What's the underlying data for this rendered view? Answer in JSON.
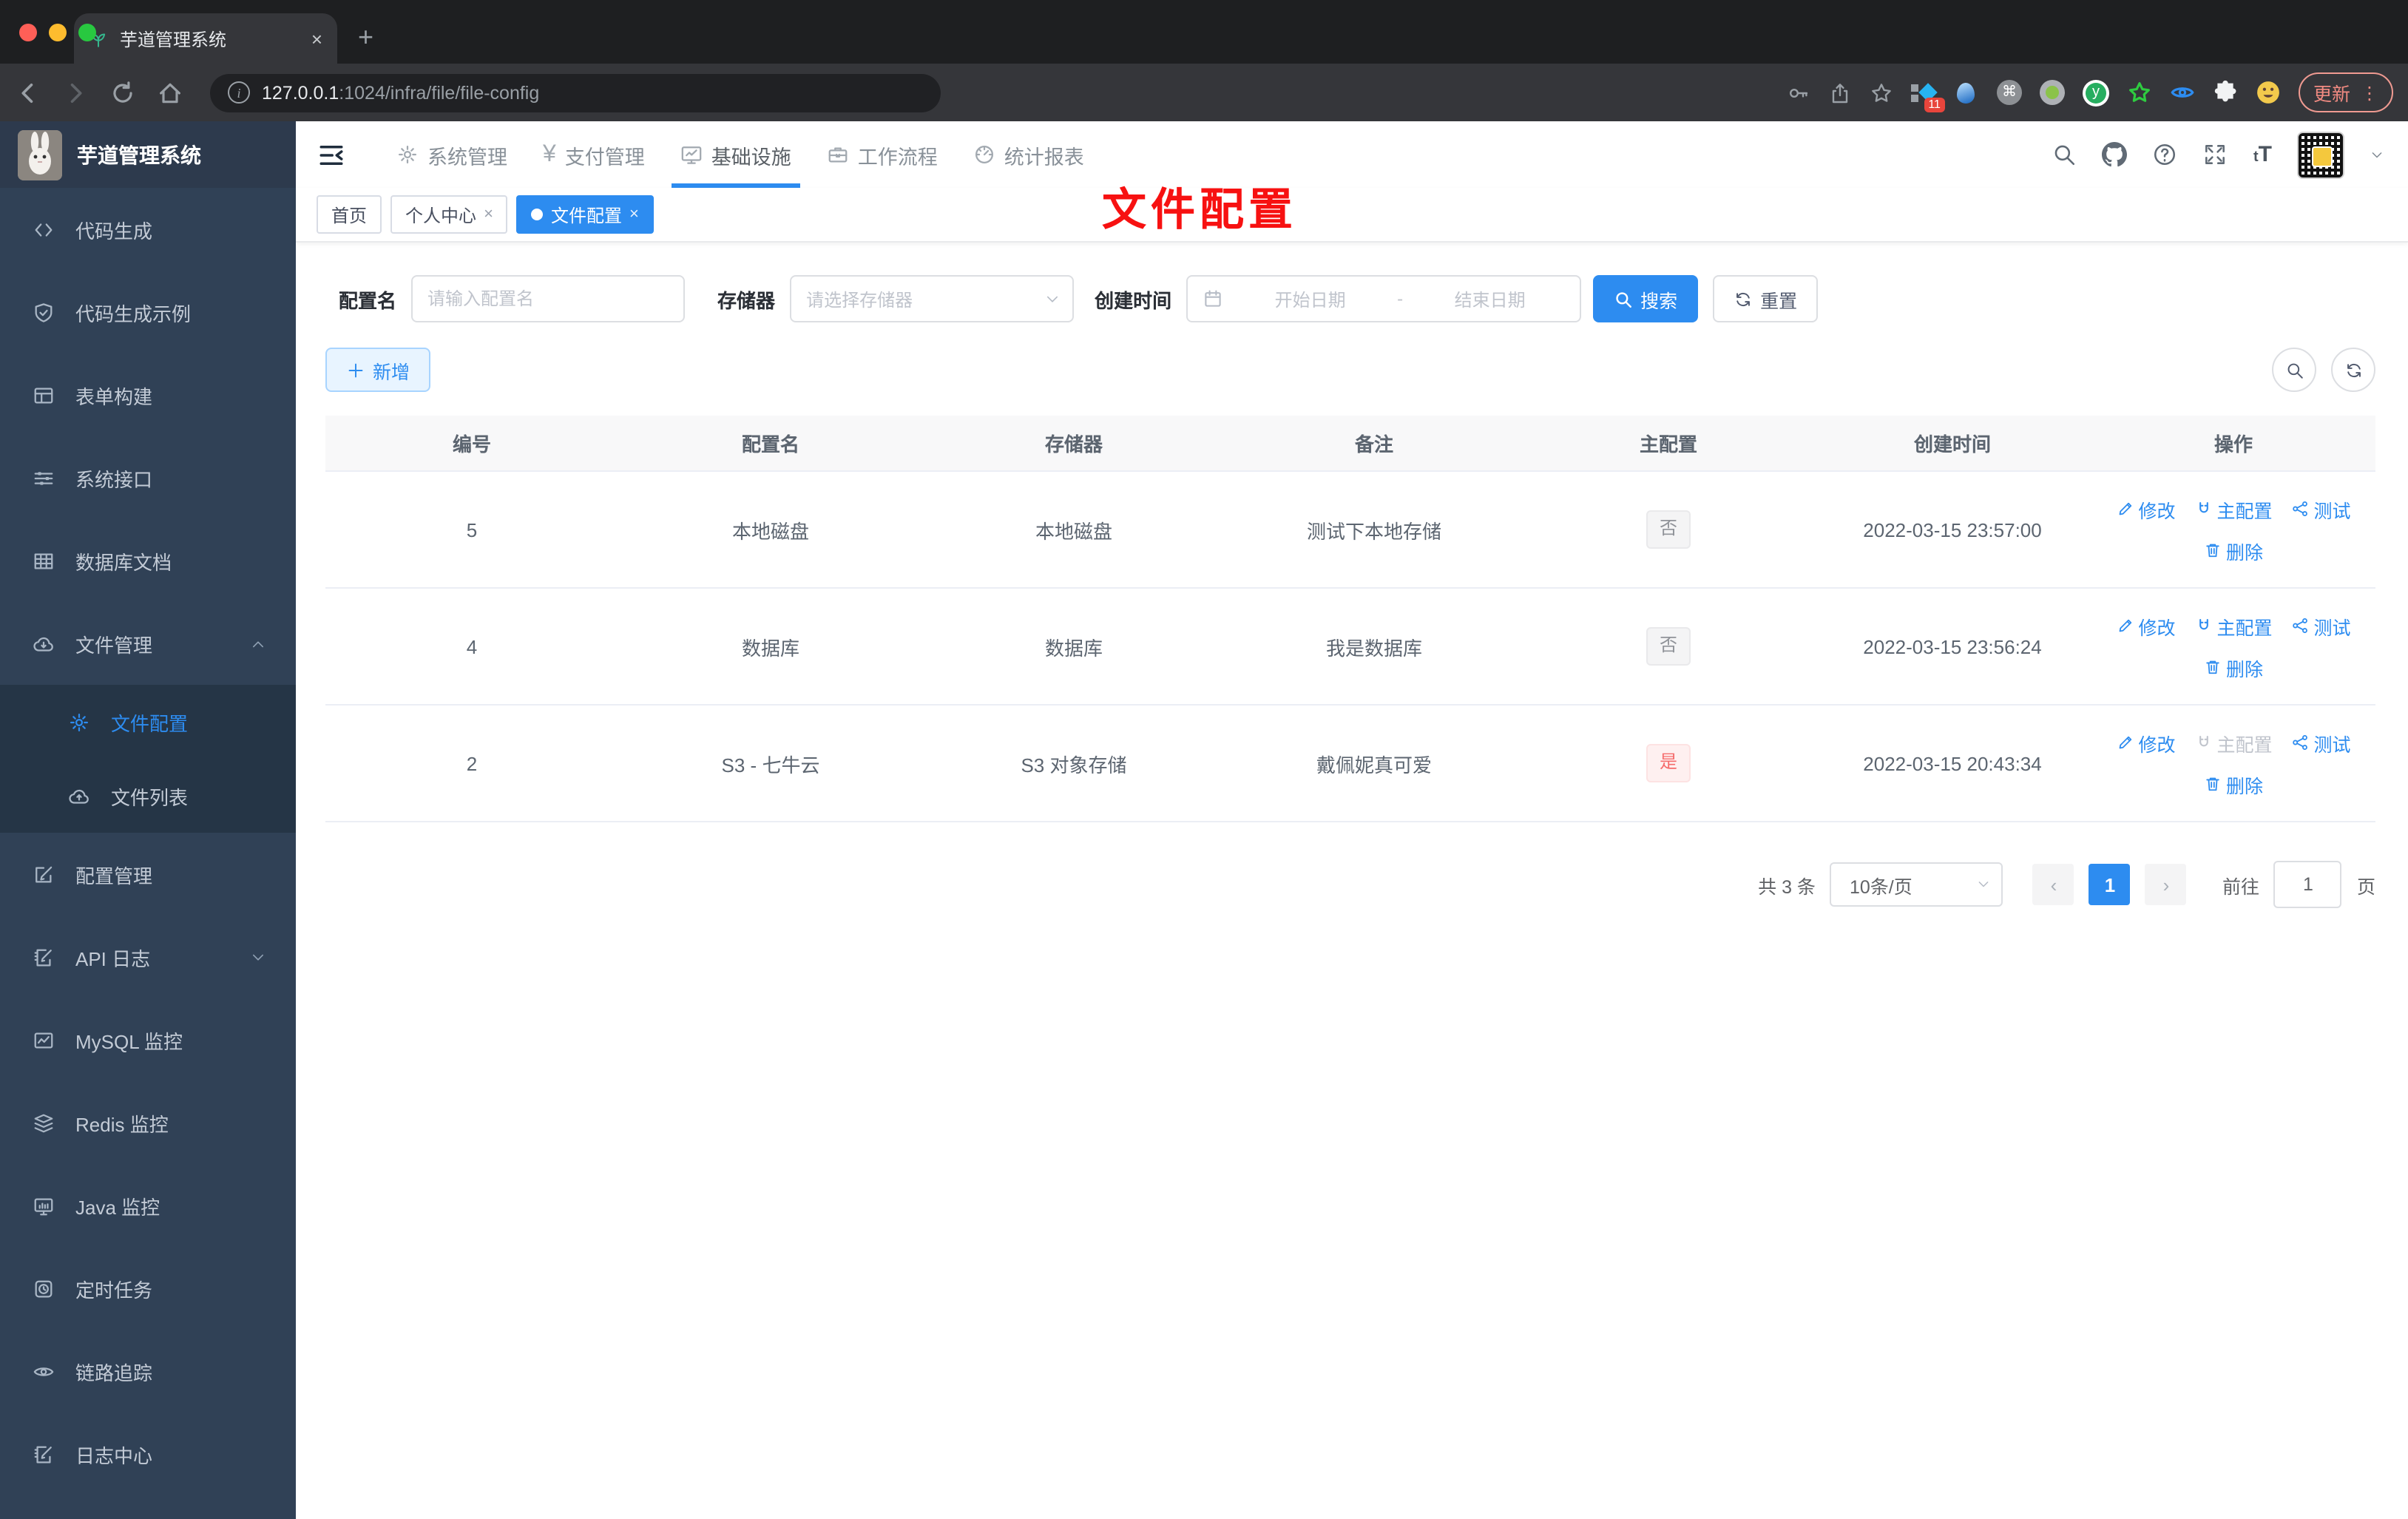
{
  "browser": {
    "tab_title": "芋道管理系统",
    "close_tab": "×",
    "new_tab": "+",
    "url_host": "127.0.0.1",
    "url_path": ":1024/infra/file/file-config",
    "ext_badge": "11",
    "update_label": "更新",
    "kebab": "⋮"
  },
  "sidebar": {
    "logo_title": "芋道管理系统",
    "items": [
      {
        "label": "代码生成",
        "icon": "code-icon"
      },
      {
        "label": "代码生成示例",
        "icon": "shield-check-icon"
      },
      {
        "label": "表单构建",
        "icon": "form-icon"
      },
      {
        "label": "系统接口",
        "icon": "sliders-icon"
      },
      {
        "label": "数据库文档",
        "icon": "grid-icon"
      },
      {
        "label": "文件管理",
        "icon": "cloud-download-icon"
      },
      {
        "label": "文件配置",
        "icon": "gear-icon"
      },
      {
        "label": "文件列表",
        "icon": "cloud-upload-icon"
      },
      {
        "label": "配置管理",
        "icon": "edit-square-icon"
      },
      {
        "label": "API 日志",
        "icon": "doc-pencil-icon"
      },
      {
        "label": "MySQL 监控",
        "icon": "chart-icon"
      },
      {
        "label": "Redis 监控",
        "icon": "layers-icon"
      },
      {
        "label": "Java 监控",
        "icon": "monitor-icon"
      },
      {
        "label": "定时任务",
        "icon": "timer-icon"
      },
      {
        "label": "链路追踪",
        "icon": "eye-icon"
      },
      {
        "label": "日志中心",
        "icon": "log-icon"
      }
    ]
  },
  "header": {
    "nav": [
      {
        "label": "系统管理",
        "icon": "gear-icon"
      },
      {
        "label": "支付管理",
        "icon": "yen-icon"
      },
      {
        "label": "基础设施",
        "icon": "screen-icon"
      },
      {
        "label": "工作流程",
        "icon": "briefcase-icon"
      },
      {
        "label": "统计报表",
        "icon": "gauge-icon"
      }
    ],
    "yen": "¥",
    "text_size": "tT"
  },
  "tags": [
    {
      "label": "首页"
    },
    {
      "label": "个人中心",
      "close": "×"
    },
    {
      "label": "文件配置",
      "close": "×"
    }
  ],
  "annotation": "文件配置",
  "filters": {
    "name_label": "配置名",
    "name_placeholder": "请输入配置名",
    "storage_label": "存储器",
    "storage_placeholder": "请选择存储器",
    "time_label": "创建时间",
    "start_placeholder": "开始日期",
    "range_sep": "-",
    "end_placeholder": "结束日期",
    "search_label": "搜索",
    "reset_label": "重置"
  },
  "toolbar": {
    "add_label": "新增"
  },
  "table": {
    "columns": [
      "编号",
      "配置名",
      "存储器",
      "备注",
      "主配置",
      "创建时间",
      "操作"
    ],
    "actions": {
      "edit": "修改",
      "master": "主配置",
      "test": "测试",
      "del": "删除"
    },
    "rows": [
      {
        "id": "5",
        "name": "本地磁盘",
        "storage": "本地磁盘",
        "remark": "测试下本地存储",
        "master": "否",
        "created": "2022-03-15 23:57:00"
      },
      {
        "id": "4",
        "name": "数据库",
        "storage": "数据库",
        "remark": "我是数据库",
        "master": "否",
        "created": "2022-03-15 23:56:24"
      },
      {
        "id": "2",
        "name": "S3 - 七牛云",
        "storage": "S3 对象存储",
        "remark": "戴佩妮真可爱",
        "master": "是",
        "created": "2022-03-15 20:43:34"
      }
    ]
  },
  "pagination": {
    "total": "共 3 条",
    "page_size": "10条/页",
    "prev": "‹",
    "page": "1",
    "next": "›",
    "goto_label": "前往",
    "goto_value": "1",
    "goto_unit": "页"
  }
}
